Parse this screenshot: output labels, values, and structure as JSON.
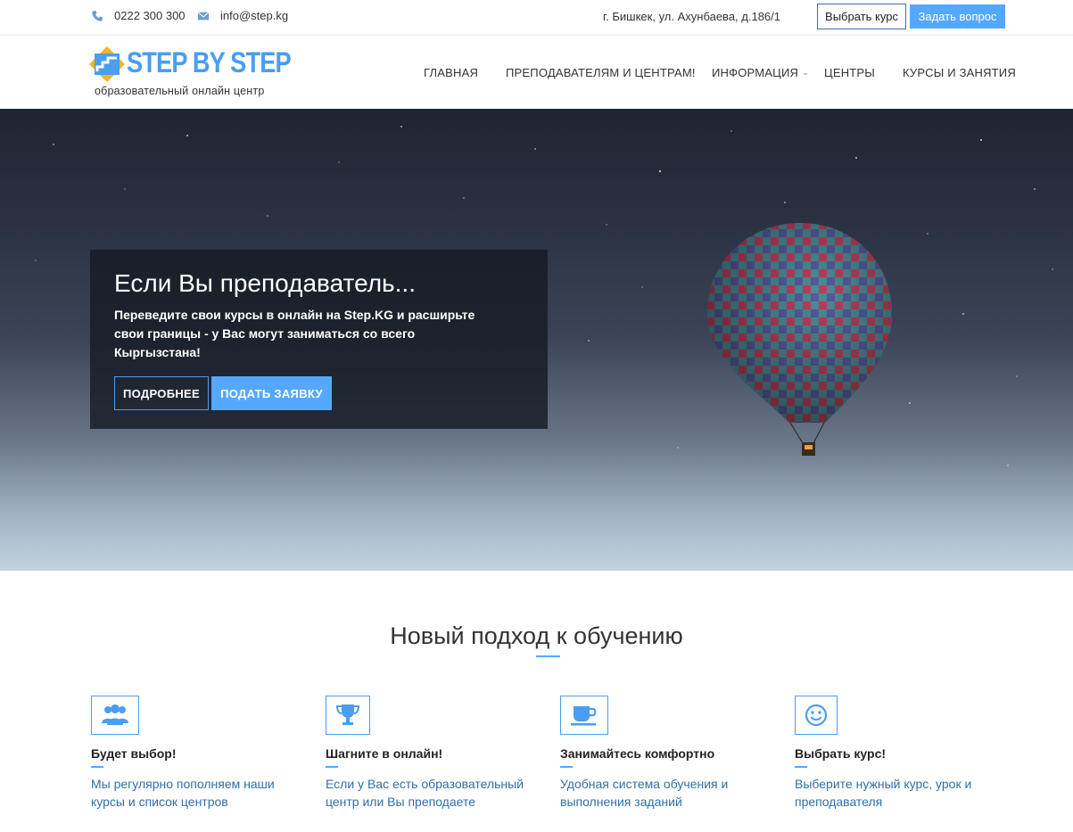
{
  "topbar": {
    "phone": "0222 300 300",
    "email": "info@step.kg",
    "address": "г. Бишкек, ул. Ахунбаева, д.186/1",
    "choose_course": "Выбрать курс",
    "ask_question": "Задать вопрос"
  },
  "logo": {
    "name": "STEP BY STEP",
    "subtitle": "образовательный онлайн центр"
  },
  "nav": {
    "items": [
      "ГЛАВНАЯ",
      "ПРЕПОДАВАТЕЛЯМ И ЦЕНТРАМ!",
      "ИНФОРМАЦИЯ",
      "ЦЕНТРЫ",
      "КУРСЫ И ЗАНЯТИЯ"
    ]
  },
  "hero": {
    "title": "Если Вы преподаватель...",
    "text": "Переведите свои курсы в онлайн на Step.KG и расширьте свои границы - у Вас могут заниматься со всего Кыргызстана!",
    "more_button": "ПОДРОБНЕЕ",
    "apply_button": "ПОДАТЬ ЗАЯВКУ"
  },
  "section": {
    "title": "Новый подход к обучению"
  },
  "features": [
    {
      "icon": "users-icon",
      "title": "Будет выбор!",
      "desc": "Мы регулярно пополняем наши курсы и список центров"
    },
    {
      "icon": "trophy-icon",
      "title": "Шагните в онлайн!",
      "desc": "Если у Вас есть образовательный центр или Вы преподаете"
    },
    {
      "icon": "coffee-icon",
      "title": "Занимайтесь комфортно",
      "desc": "Удобная система обучения и выполнения заданий"
    },
    {
      "icon": "smile-icon",
      "title": "Выбрать курс!",
      "desc": "Выберите нужный курс, урок и преподавателя"
    }
  ],
  "colors": {
    "accent": "#55a8ff",
    "link": "#2f6fa8",
    "logo": "#4a9df0"
  }
}
